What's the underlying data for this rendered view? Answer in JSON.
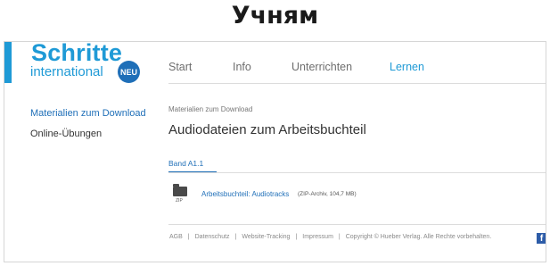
{
  "caption": "Учням",
  "logo": {
    "main": "Schritte",
    "sub": "international",
    "badge": "NEU"
  },
  "nav": [
    "Start",
    "Info",
    "Unterrichten",
    "Lernen"
  ],
  "sidebar": {
    "items": [
      "Materialien zum Download",
      "Online-Übungen"
    ]
  },
  "breadcrumb": "Materialien zum Download",
  "title": "Audiodateien zum Arbeitsbuchteil",
  "tab": "Band A1.1",
  "download": {
    "icon_label": "ZIP",
    "link": "Arbeitsbuchteil: Audiotracks",
    "meta": "(ZIP-Archiv, 104,7 MB)"
  },
  "footer": {
    "links": [
      "AGB",
      "Datenschutz",
      "Website-Tracking",
      "Impressum"
    ],
    "copyright": "Copyright © Hueber Verlag. Alle Rechte vorbehalten."
  },
  "colors": {
    "brand": "#1f9ad6",
    "link": "#1f6fb8"
  },
  "icons": [
    "folder-icon",
    "facebook-icon"
  ]
}
